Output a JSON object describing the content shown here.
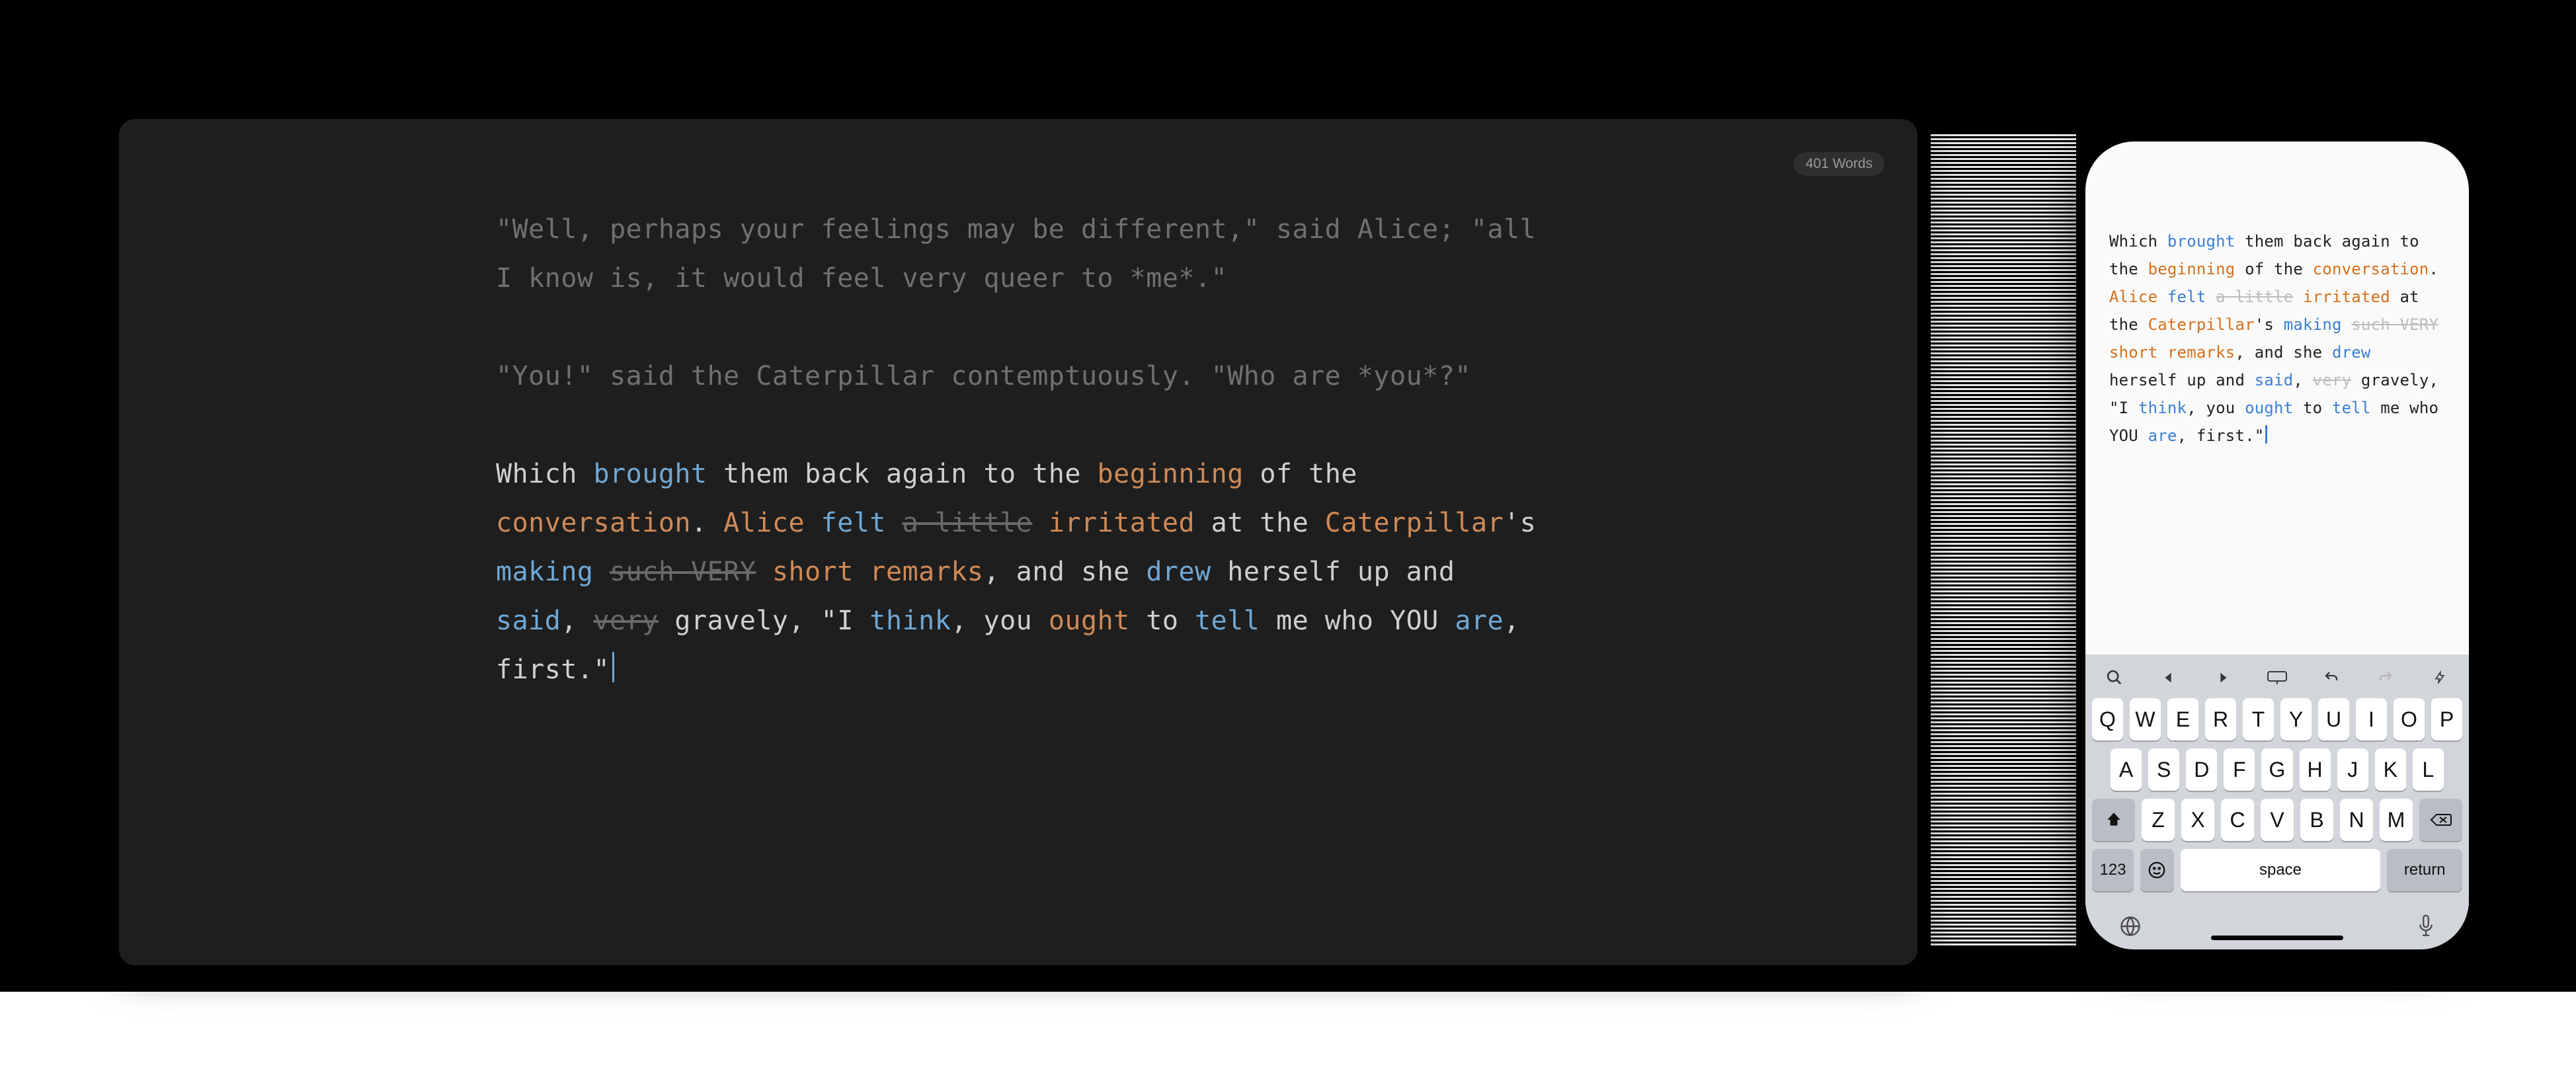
{
  "word_count_label": "401 Words",
  "desktop": {
    "dim_paragraphs": [
      "\"Well, perhaps your feelings may be different,\" said Alice; \"all I know is, it would feel very queer to *me*.\"",
      "\"You!\" said the Caterpillar contemptuously. \"Who are *you*?\""
    ],
    "tokens": [
      {
        "t": "Which ",
        "c": "plain"
      },
      {
        "t": "brought",
        "c": "blue"
      },
      {
        "t": " them back again to the ",
        "c": "plain"
      },
      {
        "t": "beginning",
        "c": "orange"
      },
      {
        "t": " of the ",
        "c": "plain"
      },
      {
        "t": "conversation",
        "c": "orange"
      },
      {
        "t": ". ",
        "c": "plain"
      },
      {
        "t": "Alice",
        "c": "orange"
      },
      {
        "t": " ",
        "c": "plain"
      },
      {
        "t": "felt",
        "c": "blue"
      },
      {
        "t": " ",
        "c": "plain"
      },
      {
        "t": "a little",
        "c": "strike"
      },
      {
        "t": " ",
        "c": "plain"
      },
      {
        "t": "irritated",
        "c": "orange"
      },
      {
        "t": " at the ",
        "c": "plain"
      },
      {
        "t": "Caterpillar",
        "c": "orange"
      },
      {
        "t": "'s ",
        "c": "plain"
      },
      {
        "t": "making",
        "c": "blue"
      },
      {
        "t": " ",
        "c": "plain"
      },
      {
        "t": "such VERY",
        "c": "strike"
      },
      {
        "t": " ",
        "c": "plain"
      },
      {
        "t": "short remarks",
        "c": "orange"
      },
      {
        "t": ", and she ",
        "c": "plain"
      },
      {
        "t": "drew",
        "c": "blue"
      },
      {
        "t": " herself up and ",
        "c": "plain"
      },
      {
        "t": "said",
        "c": "blue"
      },
      {
        "t": ", ",
        "c": "plain"
      },
      {
        "t": "very",
        "c": "strike"
      },
      {
        "t": " gravely, \"I ",
        "c": "plain"
      },
      {
        "t": "think",
        "c": "blue"
      },
      {
        "t": ", you ",
        "c": "plain"
      },
      {
        "t": "ought",
        "c": "orange"
      },
      {
        "t": " to ",
        "c": "plain"
      },
      {
        "t": "tell",
        "c": "blue"
      },
      {
        "t": " me who YOU ",
        "c": "plain"
      },
      {
        "t": "are",
        "c": "blue"
      },
      {
        "t": ", first.\"",
        "c": "plain"
      }
    ]
  },
  "phone": {
    "tokens": [
      {
        "t": "Which ",
        "c": "plain"
      },
      {
        "t": "brought",
        "c": "blue"
      },
      {
        "t": " them back again to the ",
        "c": "plain"
      },
      {
        "t": "beginning",
        "c": "orange"
      },
      {
        "t": " of the ",
        "c": "plain"
      },
      {
        "t": "conversation",
        "c": "orange"
      },
      {
        "t": ". ",
        "c": "plain"
      },
      {
        "t": "Alice",
        "c": "orange"
      },
      {
        "t": " ",
        "c": "plain"
      },
      {
        "t": "felt",
        "c": "blue"
      },
      {
        "t": " ",
        "c": "plain"
      },
      {
        "t": "a little",
        "c": "strike"
      },
      {
        "t": " ",
        "c": "plain"
      },
      {
        "t": "irritated",
        "c": "orange"
      },
      {
        "t": " at the ",
        "c": "plain"
      },
      {
        "t": "Caterpillar",
        "c": "orange"
      },
      {
        "t": "'s ",
        "c": "plain"
      },
      {
        "t": "making",
        "c": "blue"
      },
      {
        "t": " ",
        "c": "plain"
      },
      {
        "t": "such VERY",
        "c": "strike"
      },
      {
        "t": " ",
        "c": "plain"
      },
      {
        "t": "short remarks",
        "c": "orange"
      },
      {
        "t": ", and she ",
        "c": "plain"
      },
      {
        "t": "drew",
        "c": "blue"
      },
      {
        "t": " herself up and ",
        "c": "plain"
      },
      {
        "t": "said",
        "c": "blue"
      },
      {
        "t": ", ",
        "c": "plain"
      },
      {
        "t": "very",
        "c": "strike"
      },
      {
        "t": " gravely, \"I ",
        "c": "plain"
      },
      {
        "t": "think",
        "c": "blue"
      },
      {
        "t": ", you ",
        "c": "plain"
      },
      {
        "t": "ought",
        "c": "blue"
      },
      {
        "t": " to ",
        "c": "plain"
      },
      {
        "t": "tell",
        "c": "blue"
      },
      {
        "t": " me who YOU ",
        "c": "plain"
      },
      {
        "t": "are",
        "c": "blue"
      },
      {
        "t": ", first.\"",
        "c": "plain"
      }
    ],
    "keyboard": {
      "rows": [
        [
          "Q",
          "W",
          "E",
          "R",
          "T",
          "Y",
          "U",
          "I",
          "O",
          "P"
        ],
        [
          "A",
          "S",
          "D",
          "F",
          "G",
          "H",
          "J",
          "K",
          "L"
        ],
        [
          "Z",
          "X",
          "C",
          "V",
          "B",
          "N",
          "M"
        ]
      ],
      "numeric_label": "123",
      "space_label": "space",
      "return_label": "return"
    }
  }
}
